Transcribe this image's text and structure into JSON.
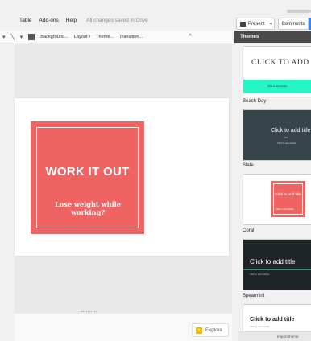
{
  "menu": {
    "items": [
      "Table",
      "Add-ons",
      "Help"
    ],
    "status": "All changes saved in Drive"
  },
  "topbar": {
    "present_label": "Present",
    "comments_label": "Comments"
  },
  "toolbar": {
    "background_label": "Background...",
    "layout_label": "Layout",
    "theme_label": "Theme...",
    "transition_label": "Transition..."
  },
  "slide": {
    "title": "WORK IT OUT",
    "subtitle": "Lose weight while working?"
  },
  "themes": {
    "header": "Themes",
    "items": [
      {
        "name": "",
        "title": "CLICK TO ADD TITLE",
        "subtitle": "Click to add subtitle"
      },
      {
        "name": "Beach Day",
        "title": "Click to add title",
        "subtitle": "Click to add subtitle"
      },
      {
        "name": "Slate",
        "title": "Click to add title",
        "subtitle": "Click to add subtitle"
      },
      {
        "name": "Coral",
        "title": "Click to add title",
        "subtitle": "Click to add subtitle"
      },
      {
        "name": "Spearmint",
        "title": "Click to add title",
        "subtitle": "Click to add subtitle"
      }
    ],
    "import_label": "Import theme"
  },
  "explore": {
    "label": "Explore"
  },
  "colors": {
    "accent": "#f06363",
    "panel_header": "#4a4a4a",
    "share": "#3b82f6",
    "beach_band": "#24f5c5"
  },
  "icons": [
    "present-icon",
    "paint-format-icon",
    "insert-box-icon",
    "chevron-up-icon",
    "explore-icon"
  ]
}
